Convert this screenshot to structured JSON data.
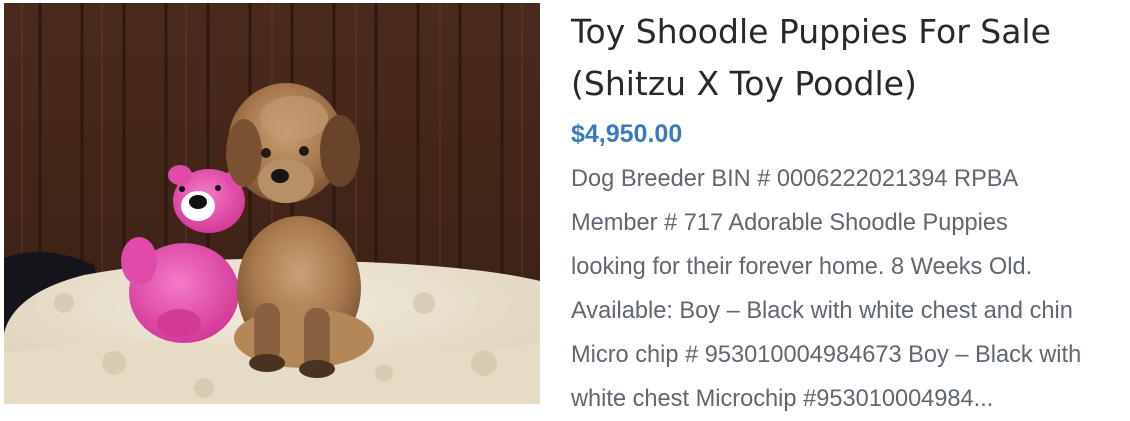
{
  "product": {
    "title": "Toy Shoodle Puppies For Sale (Shitzu X Toy Poodle)",
    "price": "$4,950.00",
    "description": "Dog Breeder BIN # 0006222021394 RPBA\nMember # 717 Adorable Shoodle Puppies\nlooking for their forever home. 8 Weeks Old.\nAvailable: Boy – Black with white chest and chin\nMicro chip # 953010004984673 Boy – Black with\nwhite chest Microchip #953010004984...",
    "image": "puppy-photo"
  },
  "colors": {
    "title": "#262a2e",
    "price": "#3a7bbf",
    "description": "#606770"
  }
}
